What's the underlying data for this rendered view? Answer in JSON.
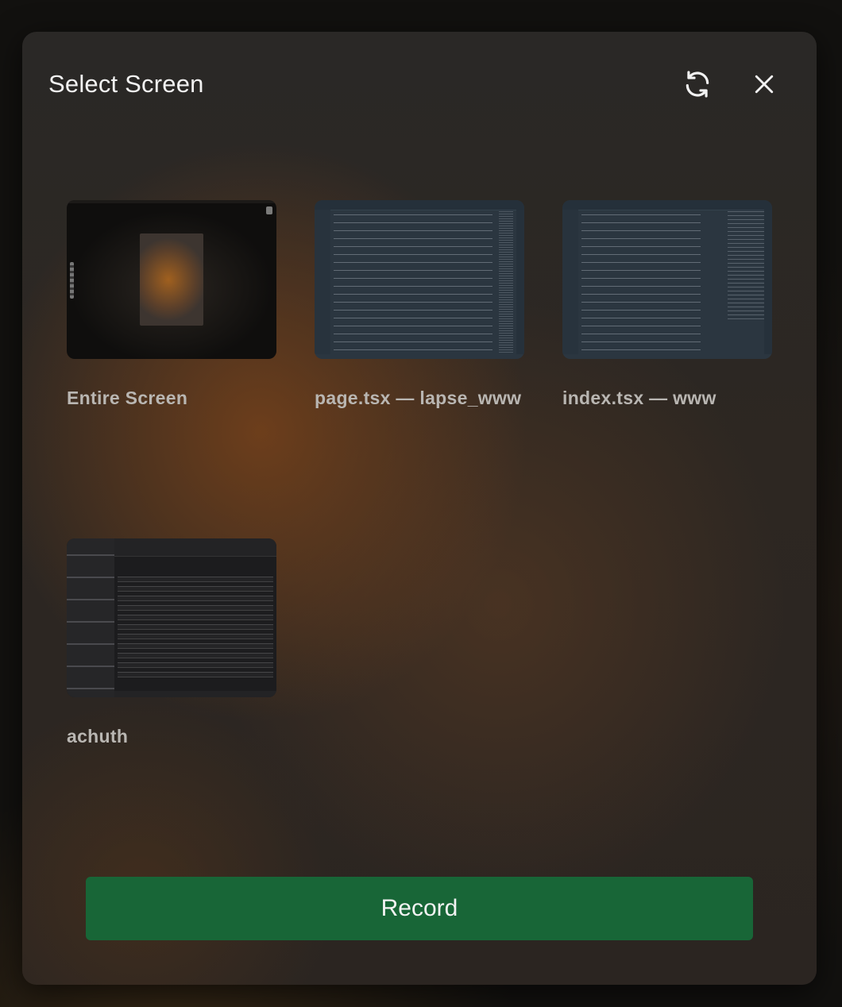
{
  "dialog": {
    "title": "Select Screen",
    "refresh_icon": "refresh-icon",
    "close_icon": "close-icon"
  },
  "sources": [
    {
      "label": "Entire Screen",
      "kind": "screen"
    },
    {
      "label": "page.tsx — lapse_www",
      "kind": "window"
    },
    {
      "label": "index.tsx — www",
      "kind": "window"
    },
    {
      "label": "achuth",
      "kind": "window"
    }
  ],
  "footer": {
    "record_label": "Record"
  },
  "colors": {
    "record_button": "#186637",
    "title_text": "#f2f2f2",
    "label_text": "#b9b6b2"
  }
}
